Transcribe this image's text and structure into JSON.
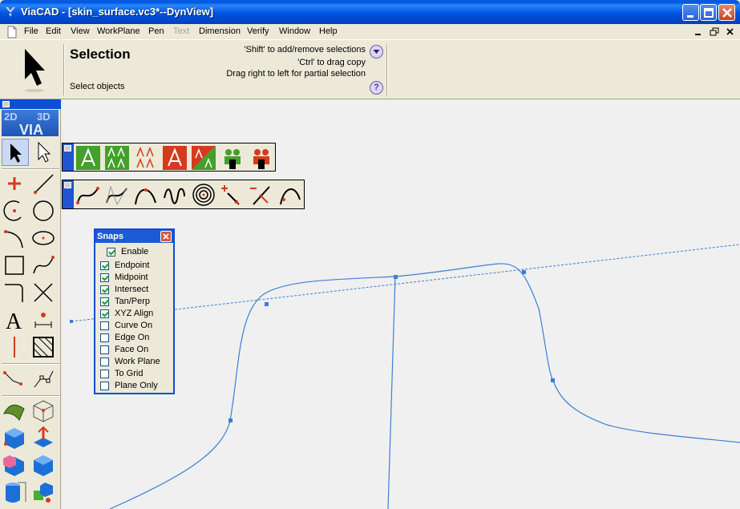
{
  "window": {
    "title": "ViaCAD - [skin_surface.vc3*--DynView]",
    "controls": [
      "minimize-icon",
      "maximize-icon",
      "close-icon"
    ]
  },
  "menu": {
    "items": [
      {
        "label": "File",
        "enabled": true
      },
      {
        "label": "Edit",
        "enabled": true
      },
      {
        "label": "View",
        "enabled": true
      },
      {
        "label": "WorkPlane",
        "enabled": true
      },
      {
        "label": "Pen",
        "enabled": true
      },
      {
        "label": "Text",
        "enabled": false
      },
      {
        "label": "Dimension",
        "enabled": true
      },
      {
        "label": "Verify",
        "enabled": true
      },
      {
        "label": "Window",
        "enabled": true
      },
      {
        "label": "Help",
        "enabled": true
      }
    ]
  },
  "info_panel": {
    "title": "Selection",
    "subtitle": "Select objects",
    "hints": [
      "'Shift' to add/remove selections",
      "'Ctrl' to drag copy",
      "Drag right to left for partial selection"
    ],
    "help_label": "?"
  },
  "palette": {
    "logo_left": "2D",
    "logo_right": "3D",
    "logo_bottom": "VIA"
  },
  "toolbars": {
    "selection_tools": [
      "select-visible-icon",
      "select-all-icon",
      "select-layer-icon",
      "select-invert-icon",
      "select-partial-icon",
      "select-group-icon",
      "deselect-group-icon"
    ],
    "curve_tools": [
      "bezier-curve-icon",
      "spline-curve-icon",
      "arc-spline-icon",
      "wave-curve-icon",
      "spiral-icon",
      "point-curve-icon",
      "tangent-curve-icon",
      "freehand-curve-icon"
    ]
  },
  "snaps": {
    "title": "Snaps",
    "enable": {
      "label": "Enable",
      "checked": true
    },
    "items": [
      {
        "label": "Endpoint",
        "checked": true
      },
      {
        "label": "Midpoint",
        "checked": true
      },
      {
        "label": "Intersect",
        "checked": true
      },
      {
        "label": "Tan/Perp",
        "checked": true
      },
      {
        "label": "XYZ Align",
        "checked": true
      },
      {
        "label": "Curve On",
        "checked": false
      },
      {
        "label": "Edge On",
        "checked": false
      },
      {
        "label": "Face On",
        "checked": false
      },
      {
        "label": "Work Plane",
        "checked": false
      },
      {
        "label": "To Grid",
        "checked": false
      },
      {
        "label": "Plane Only",
        "checked": false
      }
    ]
  },
  "colors": {
    "title_bar": "#0058e6",
    "curve": "#3a7fd5",
    "viewport_bg": "#f0f0f0",
    "palette_red": "#d63a1c"
  }
}
